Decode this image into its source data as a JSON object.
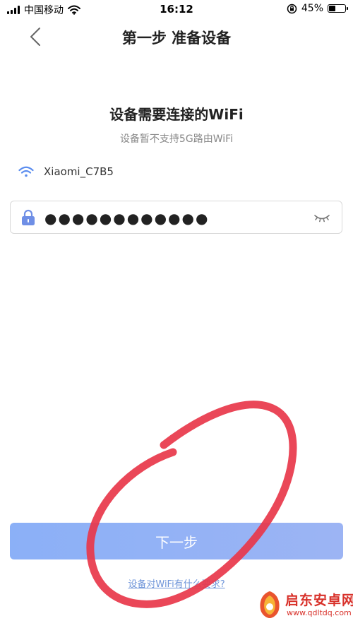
{
  "status_bar": {
    "carrier": "中国移动",
    "time": "16:12",
    "battery_percent": "45%",
    "battery_level": 0.45,
    "icons": [
      "signal-icon",
      "wifi-icon",
      "orientation-lock-icon",
      "battery-icon"
    ]
  },
  "nav": {
    "title": "第一步 准备设备",
    "back_icon": "chevron-left-icon"
  },
  "content": {
    "heading": "设备需要连接的WiFi",
    "subheading": "设备暂不支持5G路由WiFi",
    "wifi_name": "Xiaomi_C7B5",
    "wifi_icon": "wifi-icon",
    "password_value": "●●●●●●●●●●●●",
    "lock_icon": "lock-icon",
    "eye_icon": "eye-closed-icon"
  },
  "actions": {
    "next_label": "下一步",
    "help_link": "设备对WiFi有什么要求?"
  },
  "watermark": {
    "text": "启东安卓网",
    "url": "www.qdltdq.com"
  },
  "colors": {
    "accent": "#8bb0f7",
    "link": "#6f95d9",
    "wifi_icon": "#5b8def",
    "lock_icon": "#6f8fe6",
    "annotation": "#e8374a"
  }
}
